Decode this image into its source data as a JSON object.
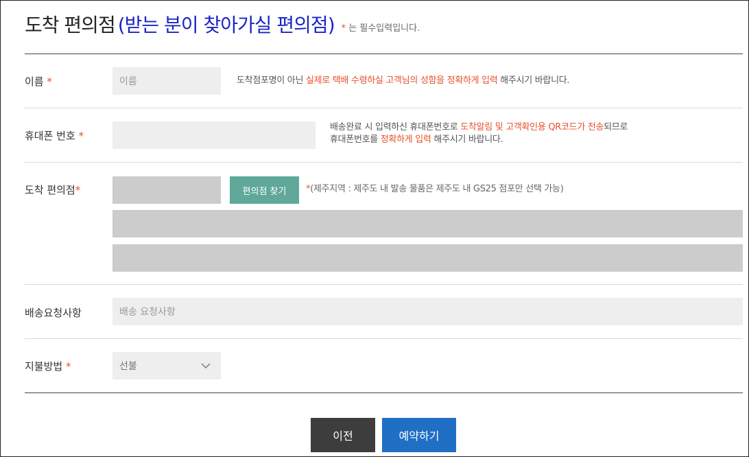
{
  "header": {
    "title": "도착 편의점",
    "subtitle": "(받는 분이 찾아가실 편의점)",
    "required_mark": "*",
    "required_note": "는 필수입력입니다."
  },
  "fields": {
    "name": {
      "label": "이름",
      "required_mark": "*",
      "placeholder": "이름",
      "desc": {
        "before": "도착점포명이 아닌 ",
        "highlight": "실제로 택배 수령하실 고객님의 성함을 정확하게 입력",
        "after": " 해주시기 바랍니다."
      }
    },
    "phone": {
      "label": "휴대폰 번호",
      "required_mark": "*",
      "placeholder": "",
      "desc": {
        "line1_before": "배송완료 시 입력하신 휴대폰번호로 ",
        "line1_highlight": "도착알림 및 고객확인용 QR코드가 전송",
        "line1_after": "되므로",
        "line2_before": "휴대폰번호를 ",
        "line2_highlight": "정확하게 입력",
        "line2_after": " 해주시기 바랍니다."
      }
    },
    "store": {
      "label": "도착 편의점",
      "required_mark": "*",
      "find_button": "편의점 찾기",
      "note_mark": "*",
      "note": "(제주지역 : 제주도 내 발송 물품은 제주도 내 GS25 점포만 선택 가능)"
    },
    "request": {
      "label": "배송요청사항",
      "placeholder": "배송 요청사항"
    },
    "payment": {
      "label": "지불방법",
      "required_mark": "*",
      "selected": "선불"
    }
  },
  "buttons": {
    "prev": "이전",
    "submit": "예약하기"
  },
  "icons": {
    "select_arrow": "chevron-down-icon"
  },
  "colors": {
    "title_sub": "#1a24c8",
    "highlight": "#e8502a",
    "find_button": "#5fa89a",
    "prev_button": "#3d3d3d",
    "submit_button": "#1f6fc4"
  }
}
